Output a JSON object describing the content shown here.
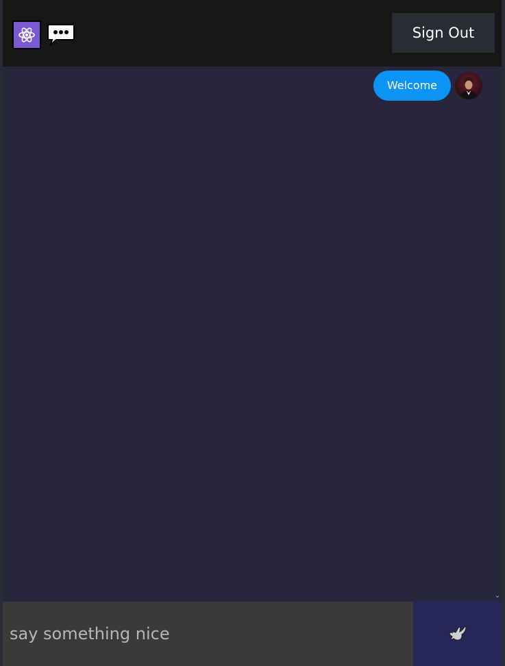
{
  "header": {
    "logo_icon": "atom-icon",
    "logo_accent": "#7b5ad1",
    "chat_icon": "speech-bubble-icon",
    "signout_label": "Sign Out"
  },
  "messages": [
    {
      "text": "Welcome",
      "sent": true,
      "bubble_color": "#0b93f6",
      "avatar": "user-avatar"
    }
  ],
  "composer": {
    "placeholder": "say something nice",
    "value": "",
    "send_icon": "dove-icon",
    "send_bg": "#272659"
  }
}
